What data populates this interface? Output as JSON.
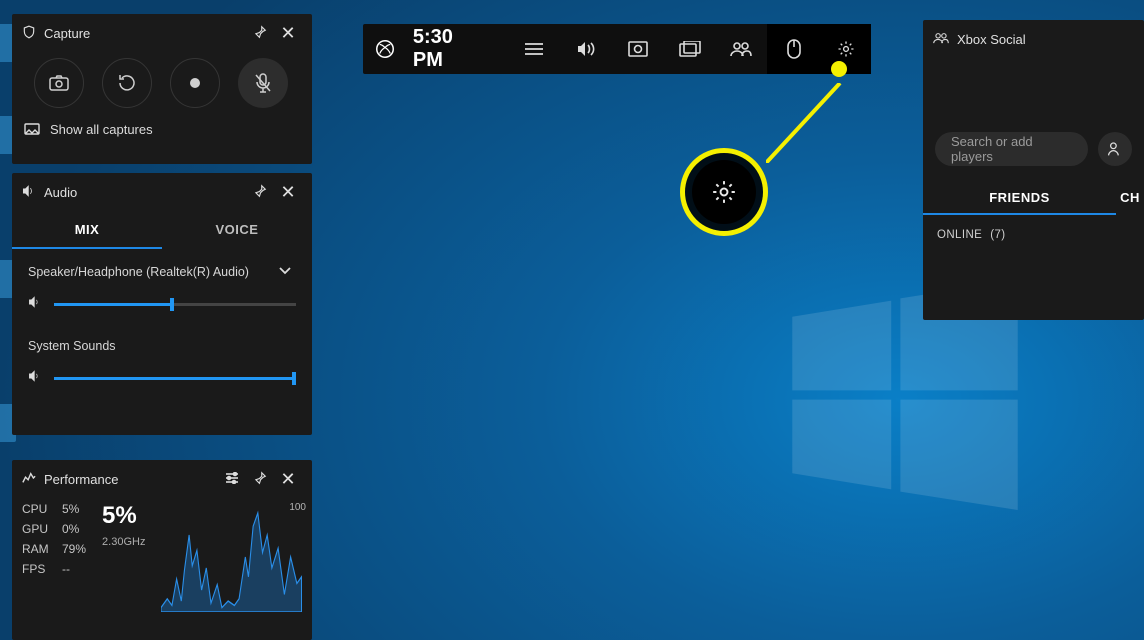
{
  "desktop": {
    "icons_hint": 4
  },
  "topbar": {
    "time": "5:30 PM",
    "icons": {
      "xbox": "xbox-logo",
      "menu": "list-icon",
      "audio": "speaker-icon",
      "capture": "camera-box-icon",
      "gallery": "picture-icon",
      "social": "people-icon",
      "mouse": "mouse-icon",
      "settings": "gear-icon"
    }
  },
  "capture": {
    "title": "Capture",
    "buttons": [
      "screenshot",
      "record-last",
      "record-start",
      "mic-muted"
    ],
    "footer": "Show all captures"
  },
  "audio": {
    "title": "Audio",
    "tabs": {
      "mix": "MIX",
      "voice": "VOICE"
    },
    "active_tab": "mix",
    "devices": [
      {
        "name": "Speaker/Headphone (Realtek(R) Audio)",
        "volume_pct": 48
      },
      {
        "name": "System Sounds",
        "volume_pct": 100
      }
    ]
  },
  "performance": {
    "title": "Performance",
    "stats": {
      "cpu_label": "CPU",
      "cpu": "5%",
      "gpu_label": "GPU",
      "gpu": "0%",
      "ram_label": "RAM",
      "ram": "79%",
      "fps_label": "FPS",
      "fps": "--"
    },
    "big_value": "5%",
    "frequency": "2.30GHz",
    "y_max": "100"
  },
  "social": {
    "title": "Xbox Social",
    "search_placeholder": "Search or add players",
    "tabs": {
      "friends": "FRIENDS",
      "chat": "CH"
    },
    "active_tab": "friends",
    "section_label": "ONLINE",
    "section_count": "(7)"
  },
  "annotation": {
    "highlighted_control": "settings-gear"
  },
  "colors": {
    "accent": "#1e88e5",
    "highlight": "#f5f000"
  }
}
